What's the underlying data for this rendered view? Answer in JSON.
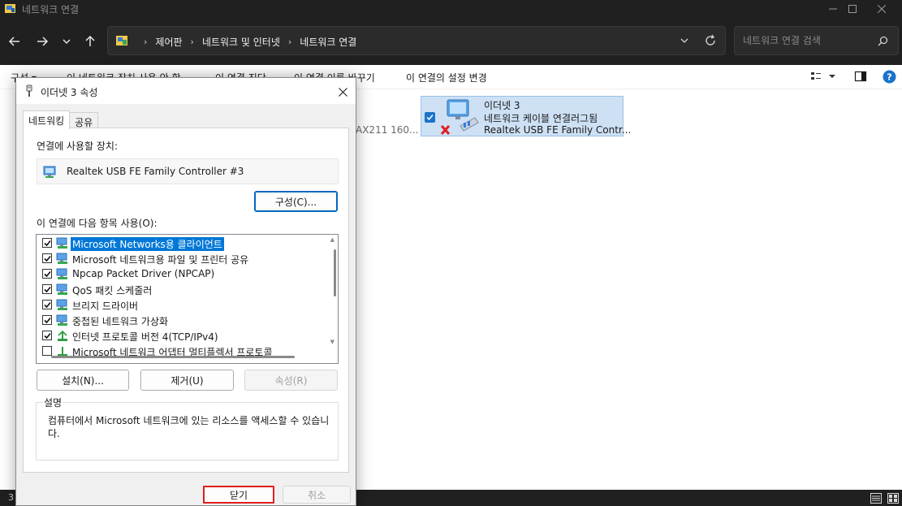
{
  "window": {
    "title": "네트워크 연결",
    "icons": {
      "app": "network-folder-icon",
      "minimize": "minimize-icon",
      "maximize": "maximize-icon",
      "close": "close-icon"
    }
  },
  "address_bar": {
    "breadcrumbs": [
      "제어판",
      "네트워크 및 인터넷",
      "네트워크 연결"
    ],
    "search_placeholder": "네트워크 연결 검색",
    "icons": {
      "back": "arrow-left-icon",
      "forward": "arrow-right-icon",
      "recent": "chevron-down-icon",
      "up": "arrow-up-icon",
      "location": "control-panel-icon",
      "dropdown": "chevron-down-icon",
      "refresh": "refresh-icon",
      "search": "search-icon"
    }
  },
  "command_bar": {
    "organize": "구성 ▾",
    "disable": "이 네트워크 장치 사용 안 함",
    "diagnose": "이 연결 진단",
    "rename": "이 연결 이름 바꾸기",
    "settings": "이 연결의 설정 변경"
  },
  "content": {
    "hidden_adapter_text": "AX211 160...",
    "adapter": {
      "name": "이더넷 3",
      "status": "네트워크 케이블 연결러그됨",
      "device": "Realtek USB FE Family Contr..."
    }
  },
  "status_bar": {
    "count": "3"
  },
  "dialog": {
    "title": "이더넷 3 속성",
    "tabs": [
      "네트워킹",
      "공유"
    ],
    "connect_using_label": "연결에 사용할 장치:",
    "device_name": "Realtek USB FE Family Controller #3",
    "configure_button": "구성(C)...",
    "items_label": "이 연결에 다음 항목 사용(O):",
    "items": [
      {
        "label": "Microsoft Networks용 클라이언트",
        "checked": true,
        "selected": true
      },
      {
        "label": "Microsoft 네트워크용 파일 및 프린터 공유",
        "checked": true
      },
      {
        "label": "Npcap Packet Driver (NPCAP)",
        "checked": true
      },
      {
        "label": "QoS 패킷 스케줄러",
        "checked": true
      },
      {
        "label": "브리지 드라이버",
        "checked": true
      },
      {
        "label": "중첩된 네트워크 가상화",
        "checked": true
      },
      {
        "label": "인터넷 프로토콜 버전 4(TCP/IPv4)",
        "checked": true
      },
      {
        "label": "Microsoft 네트워크 어댑터 멀티플렉서 프로토콜",
        "checked": false
      }
    ],
    "install_button": "설치(N)...",
    "uninstall_button": "제거(U)",
    "properties_button": "속성(R)",
    "description_title": "설명",
    "description_text": "컴퓨터에서 Microsoft 네트워크에 있는 리소스를 액세스할 수 있습니다.",
    "close_button": "닫기",
    "cancel_button": "취소"
  },
  "colors": {
    "dark_chrome": "#202020",
    "selection": "#0078d7",
    "highlight_box": "#e01e1e",
    "adapter_selected": "#cde0f4"
  }
}
